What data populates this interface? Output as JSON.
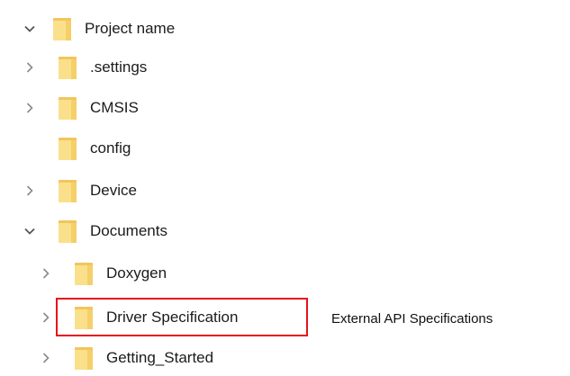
{
  "tree": {
    "items": [
      {
        "label": "Project name",
        "expander": "expanded",
        "icon": "folder-icon"
      },
      {
        "label": ".settings",
        "expander": "collapsed",
        "icon": "folder-icon"
      },
      {
        "label": "CMSIS",
        "expander": "collapsed",
        "icon": "folder-icon"
      },
      {
        "label": "config",
        "expander": "none",
        "icon": "folder-icon"
      },
      {
        "label": "Device",
        "expander": "collapsed",
        "icon": "folder-icon"
      },
      {
        "label": "Documents",
        "expander": "expanded",
        "icon": "folder-icon"
      },
      {
        "label": "Doxygen",
        "expander": "collapsed",
        "icon": "folder-icon"
      },
      {
        "label": "Driver Specification",
        "expander": "collapsed",
        "icon": "folder-icon"
      },
      {
        "label": "Getting_Started",
        "expander": "collapsed",
        "icon": "folder-icon"
      }
    ]
  },
  "annotation": {
    "text": "External API Specifications",
    "highlight_color": "#e8121a"
  },
  "colors": {
    "folder_body": "#f8d775",
    "folder_front": "#fce69b",
    "folder_edge": "#e2b93d",
    "chevron": "#6e6e6e",
    "text": "#1b1b1b"
  }
}
